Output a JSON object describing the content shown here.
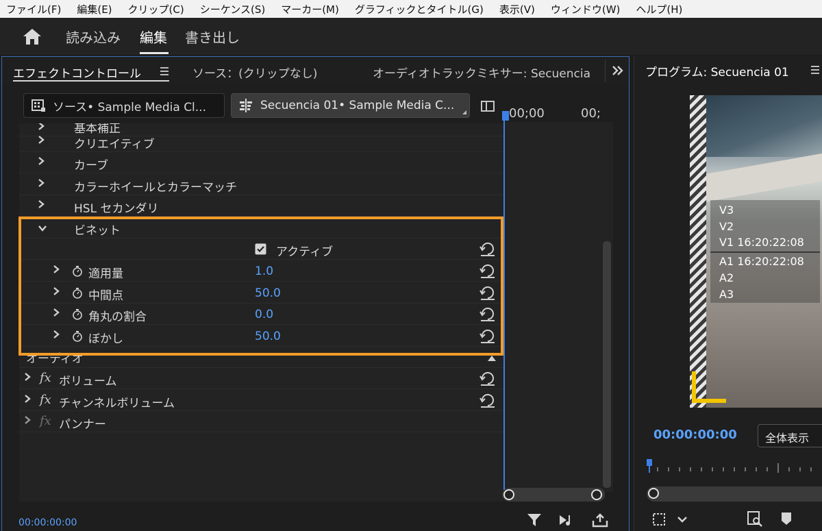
{
  "menu": [
    "ファイル(F)",
    "編集(E)",
    "クリップ(C)",
    "シーケンス(S)",
    "マーカー(M)",
    "グラフィックとタイトル(G)",
    "表示(V)",
    "ウィンドウ(W)",
    "ヘルプ(H)"
  ],
  "workspace": {
    "import": "読み込み",
    "edit": "編集",
    "export": "書き出し"
  },
  "left_tabs": {
    "effect_controls": "エフェクトコントロール",
    "source": "ソース：(クリップなし)",
    "mixer": "オーディオトラックミキサー: Secuencia"
  },
  "selectors": {
    "source": "ソース• Sample Media Cl...",
    "sequence": "Secuencia 01• Sample Media C..."
  },
  "timeline": {
    "time_start": "00;00",
    "time_end": "00;",
    "current": "00:00:00:00"
  },
  "rows": {
    "partial_top": "基本補正",
    "creative": "クリエイティブ",
    "curves": "カーブ",
    "color_wheels": "カラーホイールとカラーマッチ",
    "hsl": "HSL セカンダリ",
    "vignette": "ビネット",
    "active": "アクティブ",
    "amount_label": "適用量",
    "amount_value": "1.0",
    "midpoint_label": "中間点",
    "midpoint_value": "50.0",
    "roundness_label": "角丸の割合",
    "roundness_value": "0.0",
    "feather_label": "ぼかし",
    "feather_value": "50.0",
    "audio_header": "オーディオ",
    "volume": "ボリューム",
    "channel_volume": "チャンネルボリューム",
    "panner": "パンナー"
  },
  "fx_label": "fx",
  "program": {
    "title": "プログラム: Secuencia 01",
    "timecode": "00:00:00:00",
    "fit": "全体表示",
    "overlay": [
      "V3",
      "V2",
      "V1 16:20:22:08",
      "A1 16:20:22:08",
      "A2",
      "A3"
    ]
  },
  "colors": {
    "accent_blue": "#5aa2ff",
    "highlight_orange": "#f29c2a",
    "safe_yellow": "#f2c500"
  }
}
